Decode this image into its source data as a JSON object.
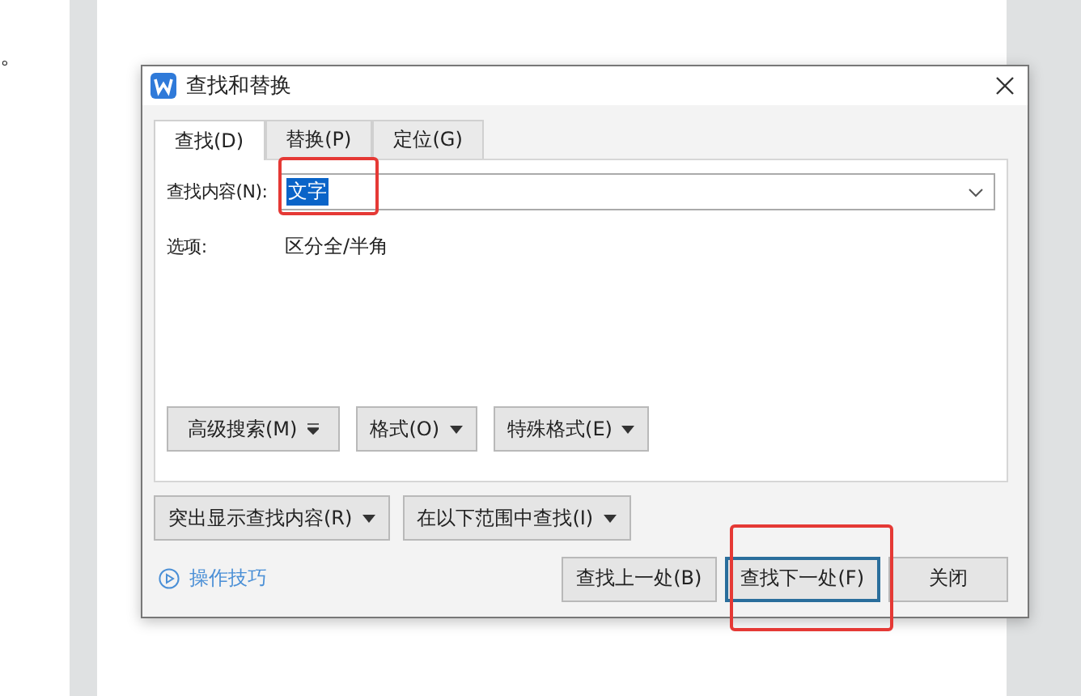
{
  "document": {
    "text": "。"
  },
  "dialog": {
    "title": "查找和替换",
    "tabs": [
      {
        "label": "查找(D)",
        "selected": true
      },
      {
        "label": "替换(P)",
        "selected": false
      },
      {
        "label": "定位(G)",
        "selected": false
      }
    ],
    "find_label": "查找内容(N):",
    "find_value": "文字",
    "options_label": "选项:",
    "options_value": "区分全/半角",
    "panel_buttons": [
      {
        "label": "高级搜索(M)",
        "kind": "expand"
      },
      {
        "label": "格式(O)",
        "kind": "dropdown"
      },
      {
        "label": "特殊格式(E)",
        "kind": "dropdown"
      }
    ],
    "lower_buttons": [
      {
        "label": "突出显示查找内容(R)"
      },
      {
        "label": "在以下范围中查找(I)"
      }
    ],
    "tips_link": "操作技巧",
    "action_buttons": [
      {
        "label": "查找上一处(B)",
        "selected": false
      },
      {
        "label": "查找下一处(F)",
        "selected": true
      },
      {
        "label": "关闭",
        "selected": false
      }
    ]
  }
}
